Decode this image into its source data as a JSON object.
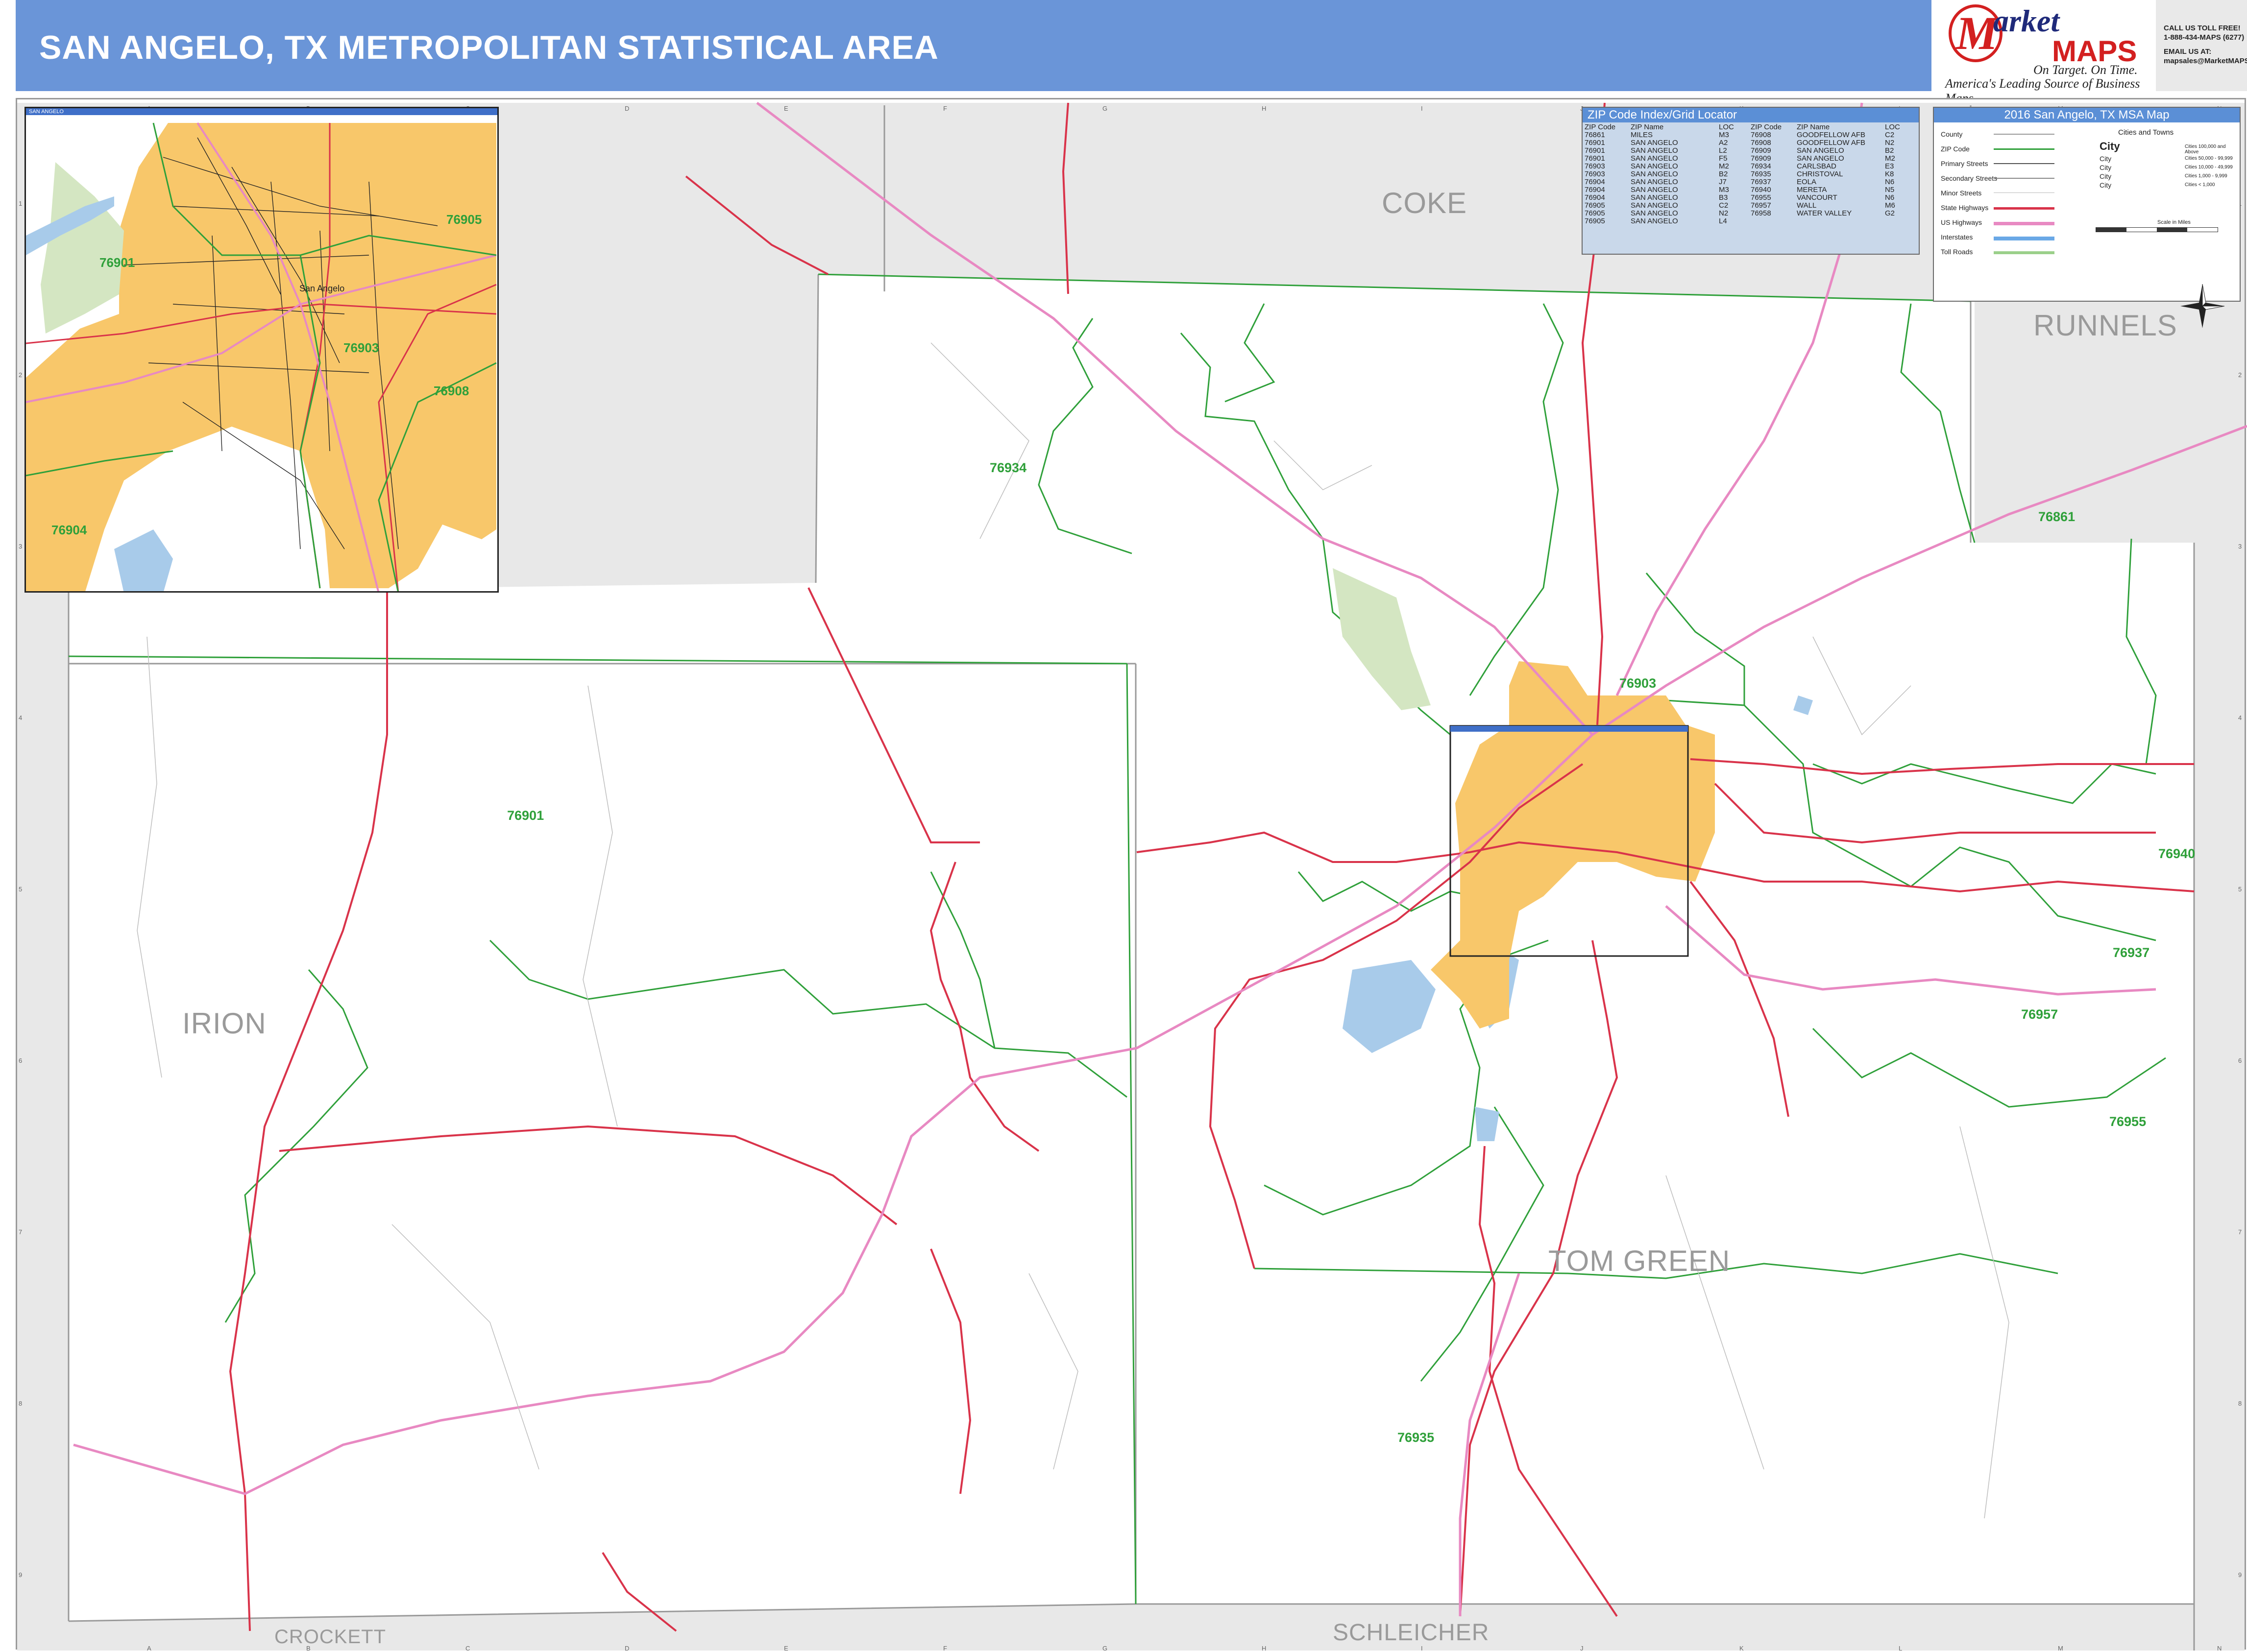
{
  "header": {
    "title": "SAN ANGELO, TX METROPOLITAN STATISTICAL AREA",
    "background": "#6a95d8"
  },
  "logo": {
    "brand_first": "arket",
    "brand_second": "MAPS",
    "tagline1": "On Target. On Time.",
    "tagline2": "America's Leading Source of Business Maps"
  },
  "contact": {
    "line1": "CALL US TOLL FREE!",
    "line2": "1-888-434-MAPS (6277)",
    "line3": "EMAIL US AT:",
    "line4": "mapsales@MarketMAPS.com"
  },
  "counties": {
    "coke": "COKE",
    "runnels": "RUNNELS",
    "irion": "IRION",
    "tom_green": "TOM GREEN",
    "crockett": "CROCKETT",
    "schleicher": "SCHLEICHER"
  },
  "zips": {
    "z76934": "76934",
    "z76901": "76901",
    "z76903": "76903",
    "z76861": "76861",
    "z76940": "76940",
    "z76937": "76937",
    "z76957": "76957",
    "z76955": "76955",
    "z76935": "76935"
  },
  "inset": {
    "bar_label": "SAN ANGELO",
    "city": "San Angelo",
    "zip_76901": "76901",
    "zip_76903": "76903",
    "zip_76905": "76905",
    "zip_76908": "76908",
    "zip_76904": "76904"
  },
  "zip_index": {
    "title": "ZIP Code Index/Grid Locator",
    "headers": [
      "ZIP Code",
      "ZIP Name",
      "LOC"
    ],
    "left": [
      [
        "76861",
        "MILES",
        "M3"
      ],
      [
        "76901",
        "SAN ANGELO",
        "A2"
      ],
      [
        "76901",
        "SAN ANGELO",
        "L2"
      ],
      [
        "76901",
        "SAN ANGELO",
        "F5"
      ],
      [
        "76903",
        "SAN ANGELO",
        "M2"
      ],
      [
        "76903",
        "SAN ANGELO",
        "B2"
      ],
      [
        "76904",
        "SAN ANGELO",
        "J7"
      ],
      [
        "76904",
        "SAN ANGELO",
        "M3"
      ],
      [
        "76904",
        "SAN ANGELO",
        "B3"
      ],
      [
        "76905",
        "SAN ANGELO",
        "C2"
      ],
      [
        "76905",
        "SAN ANGELO",
        "N2"
      ],
      [
        "76905",
        "SAN ANGELO",
        "L4"
      ]
    ],
    "right": [
      [
        "76908",
        "GOODFELLOW AFB",
        "C2"
      ],
      [
        "76908",
        "GOODFELLOW AFB",
        "N2"
      ],
      [
        "76909",
        "SAN ANGELO",
        "B2"
      ],
      [
        "76909",
        "SAN ANGELO",
        "M2"
      ],
      [
        "76934",
        "CARLSBAD",
        "E3"
      ],
      [
        "76935",
        "CHRISTOVAL",
        "K8"
      ],
      [
        "76937",
        "EOLA",
        "N6"
      ],
      [
        "76940",
        "MERETA",
        "N5"
      ],
      [
        "76955",
        "VANCOURT",
        "N6"
      ],
      [
        "76957",
        "WALL",
        "M6"
      ],
      [
        "76958",
        "WATER VALLEY",
        "G2"
      ]
    ]
  },
  "legend": {
    "title": "2016 San Angelo, TX MSA Map",
    "rows": [
      "County",
      "ZIP Code",
      "Primary Streets",
      "Secondary Streets",
      "Minor Streets",
      "State Highways",
      "US Highways",
      "Interstates",
      "Toll Roads"
    ],
    "cities_title": "Cities and Towns",
    "city_big": "City",
    "cities": [
      "City",
      "City",
      "City",
      "City"
    ],
    "pops": [
      "Cities 100,000 and Above",
      "Cities 50,000 - 99,999",
      "Cities 10,000 - 49,999",
      "Cities 1,000 - 9,999",
      "Cities < 1,000"
    ],
    "scale": "Scale in Miles"
  },
  "grid": {
    "columns": [
      "A",
      "B",
      "C",
      "D",
      "E",
      "F",
      "G",
      "H",
      "I",
      "J",
      "K",
      "L",
      "M",
      "N"
    ],
    "rows": [
      "1",
      "2",
      "3",
      "4",
      "5",
      "6",
      "7",
      "8",
      "9"
    ]
  },
  "colors": {
    "county_border": "#aaaaaa",
    "zip_border": "#2fa03a",
    "state_highway": "#d9334a",
    "us_highway": "#e889c2",
    "city_fill": "#f8c76a",
    "water": "#a8cbea",
    "outside_gray": "#e8e8e8"
  }
}
